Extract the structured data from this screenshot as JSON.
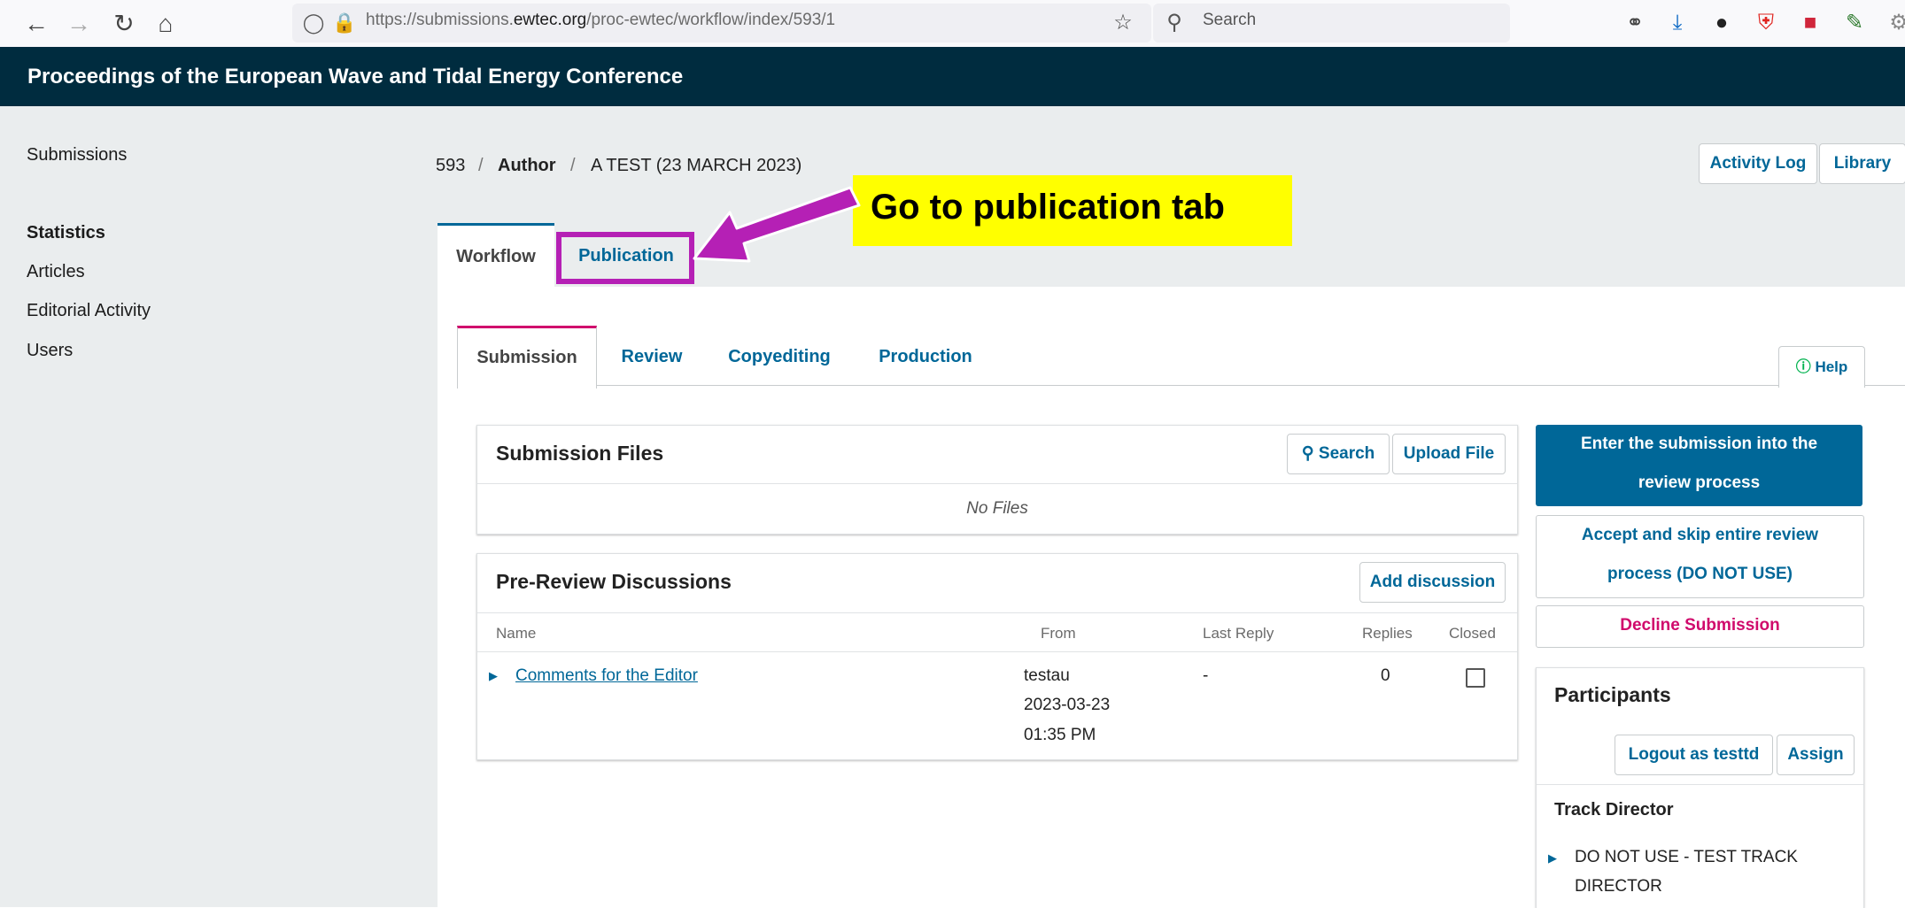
{
  "browser": {
    "back_icon": "arrow-left-icon",
    "url_prefix": "https://submissions.",
    "url_domain": "ewtec.org",
    "url_path": "/proc-ewtec/workflow/index/593/1",
    "search_placeholder": "Search"
  },
  "header": {
    "title": "Proceedings of the European Wave and Tidal Energy Conference"
  },
  "sidebar": {
    "submissions": "Submissions",
    "statistics": "Statistics",
    "articles": "Articles",
    "editorial_activity": "Editorial Activity",
    "users": "Users"
  },
  "breadcrumb": {
    "id": "593",
    "sep": "/",
    "role": "Author",
    "title": "A TEST (23 MARCH 2023)"
  },
  "header_buttons": {
    "activity_log": "Activity Log",
    "library": "Library"
  },
  "top_tabs": {
    "workflow": "Workflow",
    "publication": "Publication"
  },
  "sub_tabs": {
    "submission": "Submission",
    "review": "Review",
    "copyediting": "Copyediting",
    "production": "Production"
  },
  "help": "Help",
  "submission_files": {
    "title": "Submission Files",
    "search": "Search",
    "upload": "Upload File",
    "empty": "No Files"
  },
  "discussions": {
    "title": "Pre-Review Discussions",
    "add": "Add discussion",
    "columns": {
      "name": "Name",
      "from": "From",
      "last_reply": "Last Reply",
      "replies": "Replies",
      "closed": "Closed"
    },
    "row": {
      "name": "Comments for the Editor",
      "from_user": "testau",
      "from_date": "2023-03-23",
      "from_time": "01:35 PM",
      "last_reply": "-",
      "replies": "0"
    }
  },
  "actions": {
    "enter_review_1": "Enter the submission into the",
    "enter_review_2": "review process",
    "accept_skip_1": "Accept and skip entire review",
    "accept_skip_2": "process (DO NOT USE)",
    "decline": "Decline Submission"
  },
  "participants": {
    "title": "Participants",
    "logout_as": "Logout as testtd",
    "assign": "Assign",
    "track_director_label": "Track Director",
    "track_director_1": "DO NOT USE - TEST TRACK",
    "track_director_2": "DIRECTOR"
  },
  "annotation": {
    "callout": "Go to publication tab"
  },
  "colors": {
    "brand": "#002c3f",
    "link": "#006798",
    "primary_button": "#006798",
    "decline": "#d00a6c",
    "annotation": "#b520b5",
    "callout_bg": "#ffff00"
  }
}
